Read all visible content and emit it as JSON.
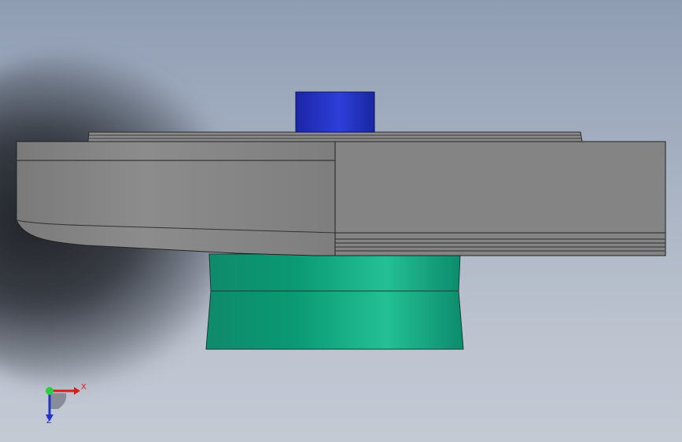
{
  "viewport": {
    "background_top": "#8f9db3",
    "background_bottom": "#c4cad4"
  },
  "model": {
    "top_boss_color": "#1e2fc0",
    "body_color": "#808080",
    "base_color": "#1faa85"
  },
  "triad": {
    "x_label": "X",
    "y_label": "Y",
    "z_label": "Z",
    "x_color": "#d41f1f",
    "y_color": "#2ecc40",
    "z_color": "#2233cc"
  }
}
